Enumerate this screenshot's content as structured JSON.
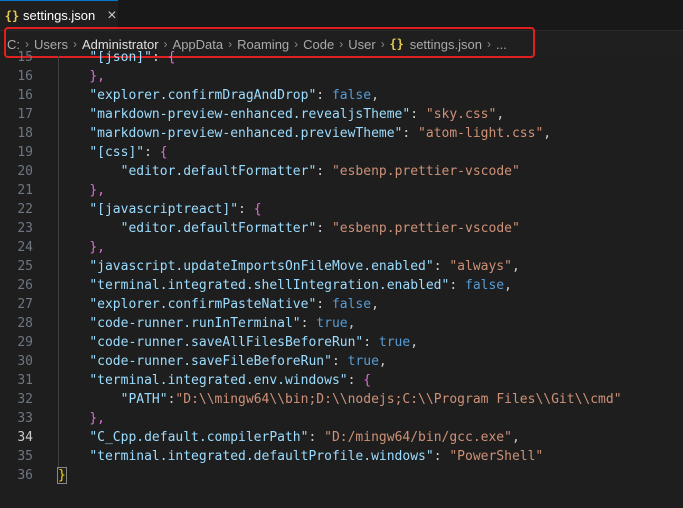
{
  "tab": {
    "label": "settings.json",
    "icon": "{}",
    "close": "×"
  },
  "breadcrumb": [
    {
      "label": "C:",
      "bold": false
    },
    {
      "label": "Users",
      "bold": false
    },
    {
      "label": "Administrator",
      "bold": true
    },
    {
      "label": "AppData",
      "bold": false
    },
    {
      "label": "Roaming",
      "bold": false
    },
    {
      "label": "Code",
      "bold": false
    },
    {
      "label": "User",
      "bold": false
    },
    {
      "label": "settings.json",
      "bold": false,
      "icon": "{}"
    },
    {
      "label": "...",
      "bold": false
    }
  ],
  "editor": {
    "active_line": 34,
    "lines": [
      {
        "n": 15,
        "tokens": [
          {
            "t": "    "
          },
          {
            "c": "k",
            "t": "\"[json]\""
          },
          {
            "t": ": "
          },
          {
            "c": "p",
            "t": "{"
          }
        ]
      },
      {
        "n": 16,
        "tokens": [
          {
            "t": "    "
          },
          {
            "c": "p",
            "t": "},"
          }
        ]
      },
      {
        "n": 16,
        "tokens": [
          {
            "t": "    "
          },
          {
            "c": "k",
            "t": "\"explorer.confirmDragAndDrop\""
          },
          {
            "t": ": "
          },
          {
            "c": "b",
            "t": "false"
          },
          {
            "t": ","
          }
        ]
      },
      {
        "n": 17,
        "tokens": [
          {
            "t": "    "
          },
          {
            "c": "k",
            "t": "\"markdown-preview-enhanced.revealjsTheme\""
          },
          {
            "t": ": "
          },
          {
            "c": "s",
            "t": "\"sky.css\""
          },
          {
            "t": ","
          }
        ]
      },
      {
        "n": 18,
        "tokens": [
          {
            "t": "    "
          },
          {
            "c": "k",
            "t": "\"markdown-preview-enhanced.previewTheme\""
          },
          {
            "t": ": "
          },
          {
            "c": "s",
            "t": "\"atom-light.css\""
          },
          {
            "t": ","
          }
        ]
      },
      {
        "n": 19,
        "tokens": [
          {
            "t": "    "
          },
          {
            "c": "k",
            "t": "\"[css]\""
          },
          {
            "t": ": "
          },
          {
            "c": "p",
            "t": "{"
          }
        ]
      },
      {
        "n": 20,
        "tokens": [
          {
            "t": "        "
          },
          {
            "c": "k",
            "t": "\"editor.defaultFormatter\""
          },
          {
            "t": ": "
          },
          {
            "c": "s",
            "t": "\"esbenp.prettier-vscode\""
          }
        ]
      },
      {
        "n": 21,
        "tokens": [
          {
            "t": "    "
          },
          {
            "c": "p",
            "t": "},"
          }
        ]
      },
      {
        "n": 22,
        "tokens": [
          {
            "t": "    "
          },
          {
            "c": "k",
            "t": "\"[javascriptreact]\""
          },
          {
            "t": ": "
          },
          {
            "c": "p",
            "t": "{"
          }
        ]
      },
      {
        "n": 23,
        "tokens": [
          {
            "t": "        "
          },
          {
            "c": "k",
            "t": "\"editor.defaultFormatter\""
          },
          {
            "t": ": "
          },
          {
            "c": "s",
            "t": "\"esbenp.prettier-vscode\""
          }
        ]
      },
      {
        "n": 24,
        "tokens": [
          {
            "t": "    "
          },
          {
            "c": "p",
            "t": "},"
          }
        ]
      },
      {
        "n": 25,
        "tokens": [
          {
            "t": "    "
          },
          {
            "c": "k",
            "t": "\"javascript.updateImportsOnFileMove.enabled\""
          },
          {
            "t": ": "
          },
          {
            "c": "s",
            "t": "\"always\""
          },
          {
            "t": ","
          }
        ]
      },
      {
        "n": 26,
        "tokens": [
          {
            "t": "    "
          },
          {
            "c": "k",
            "t": "\"terminal.integrated.shellIntegration.enabled\""
          },
          {
            "t": ": "
          },
          {
            "c": "b",
            "t": "false"
          },
          {
            "t": ","
          }
        ]
      },
      {
        "n": 27,
        "tokens": [
          {
            "t": "    "
          },
          {
            "c": "k",
            "t": "\"explorer.confirmPasteNative\""
          },
          {
            "t": ": "
          },
          {
            "c": "b",
            "t": "false"
          },
          {
            "t": ","
          }
        ]
      },
      {
        "n": 28,
        "tokens": [
          {
            "t": "    "
          },
          {
            "c": "k",
            "t": "\"code-runner.runInTerminal\""
          },
          {
            "t": ": "
          },
          {
            "c": "b",
            "t": "true"
          },
          {
            "t": ","
          }
        ]
      },
      {
        "n": 29,
        "tokens": [
          {
            "t": "    "
          },
          {
            "c": "k",
            "t": "\"code-runner.saveAllFilesBeforeRun\""
          },
          {
            "t": ": "
          },
          {
            "c": "b",
            "t": "true"
          },
          {
            "t": ","
          }
        ]
      },
      {
        "n": 30,
        "tokens": [
          {
            "t": "    "
          },
          {
            "c": "k",
            "t": "\"code-runner.saveFileBeforeRun\""
          },
          {
            "t": ": "
          },
          {
            "c": "b",
            "t": "true"
          },
          {
            "t": ","
          }
        ]
      },
      {
        "n": 31,
        "tokens": [
          {
            "t": "    "
          },
          {
            "c": "k",
            "t": "\"terminal.integrated.env.windows\""
          },
          {
            "t": ": "
          },
          {
            "c": "p",
            "t": "{"
          }
        ]
      },
      {
        "n": 32,
        "tokens": [
          {
            "t": "        "
          },
          {
            "c": "k",
            "t": "\"PATH\""
          },
          {
            "t": ":"
          },
          {
            "c": "s",
            "t": "\"D:\\\\mingw64\\\\bin;D:\\\\nodejs;C:\\\\Program Files\\\\Git\\\\cmd\""
          }
        ]
      },
      {
        "n": 33,
        "tokens": [
          {
            "t": "    "
          },
          {
            "c": "p",
            "t": "},"
          }
        ]
      },
      {
        "n": 34,
        "tokens": [
          {
            "t": "    "
          },
          {
            "c": "k",
            "t": "\"C_Cpp.default.compilerPath\""
          },
          {
            "t": ": "
          },
          {
            "c": "s",
            "t": "\"D:/mingw64/bin/gcc.exe\""
          },
          {
            "t": ","
          }
        ]
      },
      {
        "n": 35,
        "tokens": [
          {
            "t": "    "
          },
          {
            "c": "k",
            "t": "\"terminal.integrated.defaultProfile.windows\""
          },
          {
            "t": ": "
          },
          {
            "c": "s",
            "t": "\"PowerShell\""
          }
        ]
      },
      {
        "n": 36,
        "tokens": [
          {
            "c": "cursor-brace",
            "t": "}"
          }
        ]
      }
    ]
  }
}
